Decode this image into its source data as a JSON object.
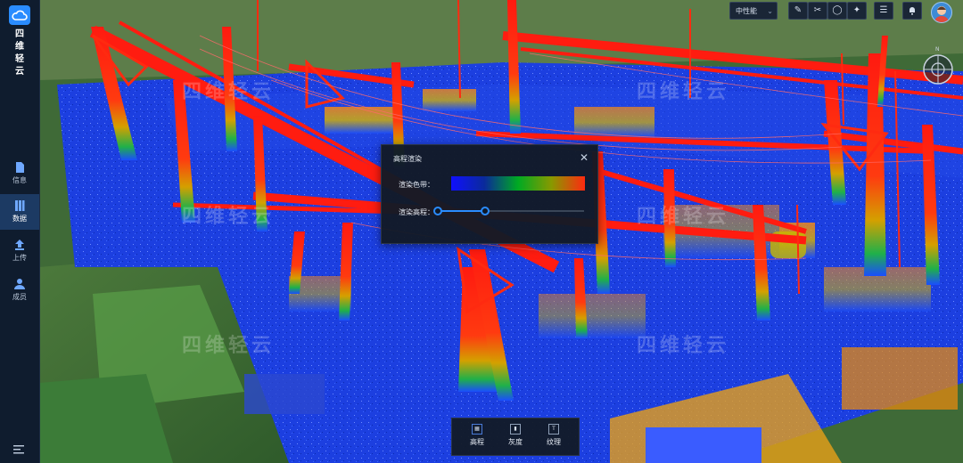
{
  "app": {
    "brand_lines": [
      "四",
      "维",
      "轻",
      "云"
    ]
  },
  "sidebar": {
    "items": [
      {
        "label": "信息",
        "icon": "file-icon",
        "active": false
      },
      {
        "label": "数据",
        "icon": "database-icon",
        "active": true
      },
      {
        "label": "上传",
        "icon": "upload-icon",
        "active": false
      },
      {
        "label": "成员",
        "icon": "users-icon",
        "active": false
      }
    ],
    "menu_icon": "menu-icon"
  },
  "toolbar": {
    "performance_select": "中性能",
    "buttons": [
      "measure-icon",
      "clip-icon",
      "globe-icon",
      "satellite-icon",
      "layers-icon",
      "bell-icon"
    ]
  },
  "watermark": {
    "text": "四维轻云"
  },
  "modal": {
    "title": "高程渲染",
    "color_band_label": "渲染色带：",
    "height_label": "渲染高程：",
    "close_icon": "close-icon",
    "color_band": [
      "#1010ff",
      "#0a2a9a",
      "#00aa22",
      "#889900",
      "#ff2a10"
    ],
    "height_range_fraction": [
      0.0,
      0.32
    ]
  },
  "render_modes": [
    {
      "label": "高程",
      "icon": "elevation-icon"
    },
    {
      "label": "灰度",
      "icon": "grayscale-icon"
    },
    {
      "label": "纹理",
      "icon": "texture-icon"
    }
  ],
  "colors": {
    "accent": "#2a8cff",
    "panel": "#121a26",
    "sidebar": "#0f1c2e"
  }
}
